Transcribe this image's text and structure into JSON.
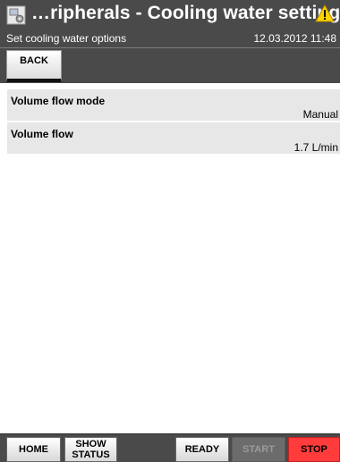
{
  "header": {
    "title": "…ripherals - Cooling water settings",
    "subtitle": "Set cooling water options",
    "timestamp": "12.03.2012 11:48",
    "app_icon": "system-settings-icon",
    "status_icon": "warning-icon"
  },
  "toolbar": {
    "back_label": "BACK"
  },
  "settings": [
    {
      "label": "Volume flow mode",
      "value": "Manual"
    },
    {
      "label": "Volume flow",
      "value": "1.7 L/min"
    }
  ],
  "footer": {
    "home_label": "HOME",
    "show_status_label_1": "SHOW",
    "show_status_label_2": "STATUS",
    "ready_label": "READY",
    "start_label": "START",
    "stop_label": "STOP"
  },
  "colors": {
    "header_bg": "#4a4a4a",
    "row_bg": "#e7e7e7",
    "warning": "#ffd200",
    "stop": "#ff3b3b"
  }
}
